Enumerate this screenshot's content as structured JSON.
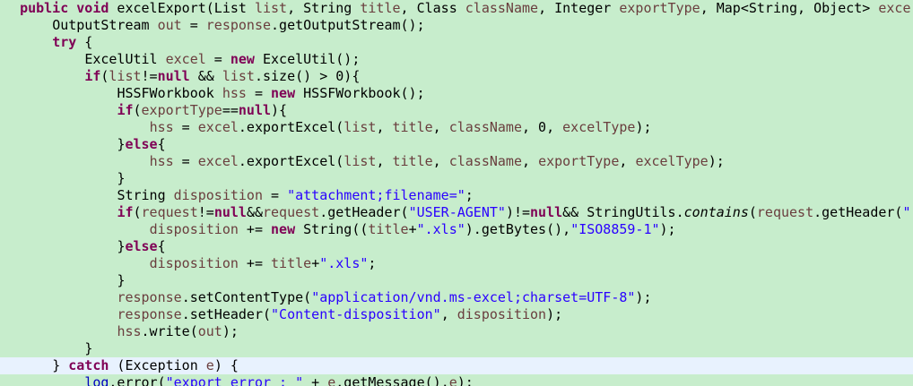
{
  "editor": {
    "colors": {
      "background": "#c7edcc",
      "current_line": "#e8f2fe",
      "keyword": "#7f0055",
      "local_variable": "#6a3e3e",
      "string": "#2a00ff",
      "plain": "#000000"
    },
    "current_line_index": 21,
    "lines": [
      {
        "indent": "  ",
        "tokens": [
          {
            "t": "kw",
            "v": "public"
          },
          {
            "t": "p",
            "v": " "
          },
          {
            "t": "kw",
            "v": "void"
          },
          {
            "t": "p",
            "v": " excelExport(List "
          },
          {
            "t": "var",
            "v": "list"
          },
          {
            "t": "p",
            "v": ", String "
          },
          {
            "t": "var",
            "v": "title"
          },
          {
            "t": "p",
            "v": ", Class "
          },
          {
            "t": "var",
            "v": "className"
          },
          {
            "t": "p",
            "v": ", Integer "
          },
          {
            "t": "var",
            "v": "exportType"
          },
          {
            "t": "p",
            "v": ", Map<String, Object> "
          },
          {
            "t": "var",
            "v": "exce"
          }
        ]
      },
      {
        "indent": "      ",
        "tokens": [
          {
            "t": "p",
            "v": "OutputStream "
          },
          {
            "t": "var",
            "v": "out"
          },
          {
            "t": "p",
            "v": " = "
          },
          {
            "t": "var",
            "v": "response"
          },
          {
            "t": "p",
            "v": ".getOutputStream();"
          }
        ]
      },
      {
        "indent": "      ",
        "tokens": [
          {
            "t": "kw",
            "v": "try"
          },
          {
            "t": "p",
            "v": " {"
          }
        ]
      },
      {
        "indent": "          ",
        "tokens": [
          {
            "t": "p",
            "v": "ExcelUtil "
          },
          {
            "t": "var",
            "v": "excel"
          },
          {
            "t": "p",
            "v": " = "
          },
          {
            "t": "kw",
            "v": "new"
          },
          {
            "t": "p",
            "v": " ExcelUtil();"
          }
        ]
      },
      {
        "indent": "          ",
        "tokens": [
          {
            "t": "kw",
            "v": "if"
          },
          {
            "t": "p",
            "v": "("
          },
          {
            "t": "var",
            "v": "list"
          },
          {
            "t": "p",
            "v": "!="
          },
          {
            "t": "kw",
            "v": "null"
          },
          {
            "t": "p",
            "v": " && "
          },
          {
            "t": "var",
            "v": "list"
          },
          {
            "t": "p",
            "v": ".size() > 0){"
          }
        ]
      },
      {
        "indent": "              ",
        "tokens": [
          {
            "t": "p",
            "v": "HSSFWorkbook "
          },
          {
            "t": "var",
            "v": "hss"
          },
          {
            "t": "p",
            "v": " = "
          },
          {
            "t": "kw",
            "v": "new"
          },
          {
            "t": "p",
            "v": " HSSFWorkbook();"
          }
        ]
      },
      {
        "indent": "              ",
        "tokens": [
          {
            "t": "kw",
            "v": "if"
          },
          {
            "t": "p",
            "v": "("
          },
          {
            "t": "var",
            "v": "exportType"
          },
          {
            "t": "p",
            "v": "=="
          },
          {
            "t": "kw",
            "v": "null"
          },
          {
            "t": "p",
            "v": "){"
          }
        ]
      },
      {
        "indent": "                  ",
        "tokens": [
          {
            "t": "var",
            "v": "hss"
          },
          {
            "t": "p",
            "v": " = "
          },
          {
            "t": "var",
            "v": "excel"
          },
          {
            "t": "p",
            "v": ".exportExcel("
          },
          {
            "t": "var",
            "v": "list"
          },
          {
            "t": "p",
            "v": ", "
          },
          {
            "t": "var",
            "v": "title"
          },
          {
            "t": "p",
            "v": ", "
          },
          {
            "t": "var",
            "v": "className"
          },
          {
            "t": "p",
            "v": ", 0, "
          },
          {
            "t": "var",
            "v": "excelType"
          },
          {
            "t": "p",
            "v": ");"
          }
        ]
      },
      {
        "indent": "              ",
        "tokens": [
          {
            "t": "p",
            "v": "}"
          },
          {
            "t": "kw",
            "v": "else"
          },
          {
            "t": "p",
            "v": "{"
          }
        ]
      },
      {
        "indent": "                  ",
        "tokens": [
          {
            "t": "var",
            "v": "hss"
          },
          {
            "t": "p",
            "v": " = "
          },
          {
            "t": "var",
            "v": "excel"
          },
          {
            "t": "p",
            "v": ".exportExcel("
          },
          {
            "t": "var",
            "v": "list"
          },
          {
            "t": "p",
            "v": ", "
          },
          {
            "t": "var",
            "v": "title"
          },
          {
            "t": "p",
            "v": ", "
          },
          {
            "t": "var",
            "v": "className"
          },
          {
            "t": "p",
            "v": ", "
          },
          {
            "t": "var",
            "v": "exportType"
          },
          {
            "t": "p",
            "v": ", "
          },
          {
            "t": "var",
            "v": "excelType"
          },
          {
            "t": "p",
            "v": ");"
          }
        ]
      },
      {
        "indent": "              ",
        "tokens": [
          {
            "t": "p",
            "v": "}"
          }
        ]
      },
      {
        "indent": "              ",
        "tokens": [
          {
            "t": "p",
            "v": "String "
          },
          {
            "t": "var",
            "v": "disposition"
          },
          {
            "t": "p",
            "v": " = "
          },
          {
            "t": "str",
            "v": "\"attachment;filename=\""
          },
          {
            "t": "p",
            "v": ";"
          }
        ]
      },
      {
        "indent": "              ",
        "tokens": [
          {
            "t": "kw",
            "v": "if"
          },
          {
            "t": "p",
            "v": "("
          },
          {
            "t": "var",
            "v": "request"
          },
          {
            "t": "p",
            "v": "!="
          },
          {
            "t": "kw",
            "v": "null"
          },
          {
            "t": "p",
            "v": "&&"
          },
          {
            "t": "var",
            "v": "request"
          },
          {
            "t": "p",
            "v": ".getHeader("
          },
          {
            "t": "str",
            "v": "\"USER-AGENT\""
          },
          {
            "t": "p",
            "v": ")!="
          },
          {
            "t": "kw",
            "v": "null"
          },
          {
            "t": "p",
            "v": "&& StringUtils."
          },
          {
            "t": "stat",
            "v": "contains"
          },
          {
            "t": "p",
            "v": "("
          },
          {
            "t": "var",
            "v": "request"
          },
          {
            "t": "p",
            "v": ".getHeader("
          },
          {
            "t": "str",
            "v": "\""
          }
        ]
      },
      {
        "indent": "                  ",
        "tokens": [
          {
            "t": "var",
            "v": "disposition"
          },
          {
            "t": "p",
            "v": " += "
          },
          {
            "t": "kw",
            "v": "new"
          },
          {
            "t": "p",
            "v": " String(("
          },
          {
            "t": "var",
            "v": "title"
          },
          {
            "t": "p",
            "v": "+"
          },
          {
            "t": "str",
            "v": "\".xls\""
          },
          {
            "t": "p",
            "v": ").getBytes(),"
          },
          {
            "t": "str",
            "v": "\"ISO8859-1\""
          },
          {
            "t": "p",
            "v": ");"
          }
        ]
      },
      {
        "indent": "              ",
        "tokens": [
          {
            "t": "p",
            "v": "}"
          },
          {
            "t": "kw",
            "v": "else"
          },
          {
            "t": "p",
            "v": "{"
          }
        ]
      },
      {
        "indent": "                  ",
        "tokens": [
          {
            "t": "var",
            "v": "disposition"
          },
          {
            "t": "p",
            "v": " += "
          },
          {
            "t": "var",
            "v": "title"
          },
          {
            "t": "p",
            "v": "+"
          },
          {
            "t": "str",
            "v": "\".xls\""
          },
          {
            "t": "p",
            "v": ";"
          }
        ]
      },
      {
        "indent": "              ",
        "tokens": [
          {
            "t": "p",
            "v": "}"
          }
        ]
      },
      {
        "indent": "              ",
        "tokens": [
          {
            "t": "var",
            "v": "response"
          },
          {
            "t": "p",
            "v": ".setContentType("
          },
          {
            "t": "str",
            "v": "\"application/vnd.ms-excel;charset=UTF-8\""
          },
          {
            "t": "p",
            "v": ");"
          }
        ]
      },
      {
        "indent": "              ",
        "tokens": [
          {
            "t": "var",
            "v": "response"
          },
          {
            "t": "p",
            "v": ".setHeader("
          },
          {
            "t": "str",
            "v": "\"Content-disposition\""
          },
          {
            "t": "p",
            "v": ", "
          },
          {
            "t": "var",
            "v": "disposition"
          },
          {
            "t": "p",
            "v": ");"
          }
        ]
      },
      {
        "indent": "              ",
        "tokens": [
          {
            "t": "var",
            "v": "hss"
          },
          {
            "t": "p",
            "v": ".write("
          },
          {
            "t": "var",
            "v": "out"
          },
          {
            "t": "p",
            "v": ");"
          }
        ]
      },
      {
        "indent": "          ",
        "tokens": [
          {
            "t": "p",
            "v": "}"
          }
        ]
      },
      {
        "indent": "      ",
        "tokens": [
          {
            "t": "p",
            "v": "} "
          },
          {
            "t": "kw",
            "v": "catch"
          },
          {
            "t": "p",
            "v": " (Exception "
          },
          {
            "t": "var",
            "v": "e"
          },
          {
            "t": "p",
            "v": ") {"
          }
        ]
      },
      {
        "indent": "          ",
        "tokens": [
          {
            "t": "fld",
            "v": "log"
          },
          {
            "t": "p",
            "v": ".error("
          },
          {
            "t": "str",
            "v": "\"export error : \""
          },
          {
            "t": "p",
            "v": " + "
          },
          {
            "t": "var",
            "v": "e"
          },
          {
            "t": "p",
            "v": ".getMessage(),"
          },
          {
            "t": "var",
            "v": "e"
          },
          {
            "t": "p",
            "v": ");"
          }
        ]
      }
    ]
  }
}
